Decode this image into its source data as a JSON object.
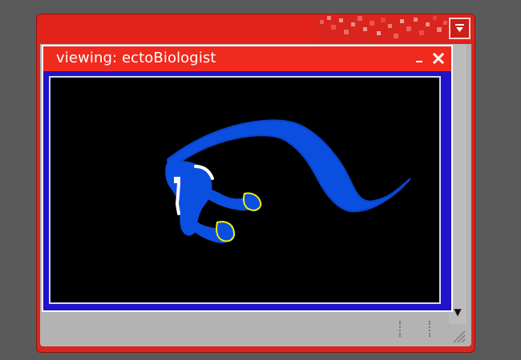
{
  "window": {
    "title": "viewing: ectoBiologist"
  },
  "icons": {
    "outer_menu": "window-menu-icon",
    "minimize": "minimize-icon",
    "close": "close-icon",
    "scroll_down": "chevron-down-icon",
    "resize_grip": "resize-grip-icon"
  },
  "colors": {
    "outer_frame": "#d9261e",
    "titlebar": "#f02a1d",
    "content_border": "#2113c7",
    "viewport_background": "#000000",
    "figure_blue": "#0b4fe0",
    "figure_highlight": "#f4f000",
    "figure_white": "#ffffff"
  }
}
